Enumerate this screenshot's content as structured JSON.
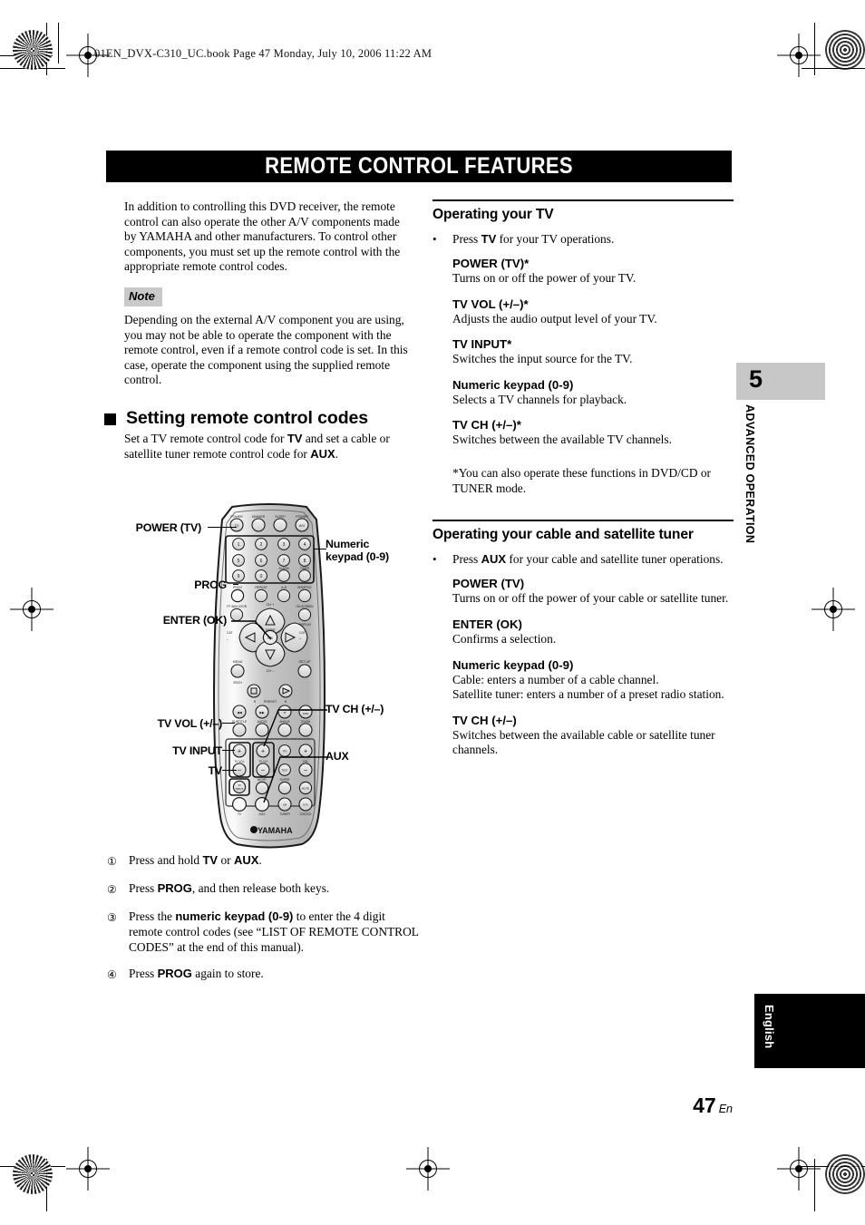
{
  "header": {
    "file_line": "01EN_DVX-C310_UC.book  Page 47  Monday, July 10, 2006  11:22 AM"
  },
  "title": "REMOTE CONTROL FEATURES",
  "left_column": {
    "intro": "In addition to controlling this DVD receiver, the remote control can also operate the other A/V components made by YAMAHA and other manufacturers. To control other components, you must set up the remote control with the appropriate remote control codes.",
    "note_label": "Note",
    "note_text": "Depending on the external A/V component you are using, you may not be able to operate the component with the remote control, even if a remote control code is set. In this case, operate the component using the supplied remote control.",
    "section_heading": "Setting remote control codes",
    "section_intro_1": "Set a TV remote control code for ",
    "section_intro_bold_1": "TV",
    "section_intro_2": " and set a cable or satellite tuner remote control code for ",
    "section_intro_bold_2": "AUX",
    "section_intro_3": "."
  },
  "figure": {
    "callouts_left": [
      {
        "label": "POWER (TV)"
      },
      {
        "label": "PROG"
      },
      {
        "label": "ENTER (OK)"
      },
      {
        "label": "TV VOL (+/–)"
      },
      {
        "label": "TV INPUT"
      },
      {
        "label": "TV"
      }
    ],
    "callouts_right": [
      {
        "label": "Numeric",
        "label2": "keypad (0-9)"
      },
      {
        "label": "TV CH (+/–)"
      },
      {
        "label": "AUX"
      }
    ],
    "remote_brand": "YAMAHA",
    "button_labels": {
      "top_row": [
        "POWER",
        "DIMMER",
        "SLEEP",
        "POWER"
      ],
      "top_row_inner": [
        "TV",
        "",
        "",
        "A/V"
      ],
      "keypad": [
        "1",
        "2",
        "3",
        "4",
        "5",
        "6",
        "7",
        "8",
        "9",
        "0"
      ],
      "row_prog": [
        "PROG",
        "REPEAT",
        "A-B",
        "SHUFFLE"
      ],
      "row_osd": [
        "TP INDICATOR",
        "ON SCREEN"
      ],
      "display": "DISPLAY",
      "nav_up": "CH +",
      "nav_down": "CH –",
      "nav_left": "CAT –",
      "nav_right": "CAT +",
      "enter": "ENTER",
      "enter_inner": "OK",
      "menu": "MENU",
      "setup": "SET UP",
      "srch": "SRCH",
      "preset": "PRESET",
      "row_media": [
        "SUBTITLE",
        "AUDIO",
        "ANGLE",
        "ZOOM"
      ],
      "tv_vol": "TV VOL",
      "tv_ch": "TV CH",
      "vol": "VOL",
      "tv_input": "TV INPUT",
      "test": "TEST",
      "mute": "MUTE",
      "night": "NIGHT",
      "super": "SUPER",
      "sources": [
        "TV",
        "AUX",
        "TUNER",
        "DVD/CD"
      ]
    }
  },
  "steps": [
    {
      "num": "①",
      "pre": "Press and hold ",
      "bold": "TV",
      "mid": " or ",
      "bold2": "AUX",
      "post": "."
    },
    {
      "num": "②",
      "pre": "Press ",
      "bold": "PROG",
      "mid": ", and then release both keys.",
      "bold2": "",
      "post": ""
    },
    {
      "num": "③",
      "pre": "Press the ",
      "bold": "numeric keypad (0-9)",
      "mid": " to enter the 4 digit remote control codes (see “LIST OF REMOTE CONTROL CODES” at the end of this manual).",
      "bold2": "",
      "post": ""
    },
    {
      "num": "④",
      "pre": "Press ",
      "bold": "PROG",
      "mid": " again to store.",
      "bold2": "",
      "post": ""
    }
  ],
  "right_column": {
    "section1": {
      "heading": "Operating your TV",
      "bullet_mark": "•",
      "bullet_pre": "Press ",
      "bullet_bold": "TV",
      "bullet_post": " for your TV operations.",
      "items": [
        {
          "term": "POWER (TV)*",
          "desc": "Turns on or off the power of your TV."
        },
        {
          "term": "TV VOL (+/–)*",
          "desc": "Adjusts the audio output level of your TV."
        },
        {
          "term": "TV INPUT*",
          "desc": "Switches the input source for the TV."
        },
        {
          "term": "Numeric keypad (0-9)",
          "desc": "Selects a TV channels for playback."
        },
        {
          "term": "TV CH (+/–)*",
          "desc": "Switches between the available TV channels."
        }
      ],
      "footnote": "*You can also operate these functions in DVD/CD or TUNER mode."
    },
    "section2": {
      "heading": "Operating your cable and satellite tuner",
      "bullet_mark": "•",
      "bullet_pre": "Press ",
      "bullet_bold": "AUX",
      "bullet_post": " for your cable and satellite tuner operations.",
      "items": [
        {
          "term": "POWER (TV)",
          "desc": "Turns on or off the power of your cable or satellite tuner."
        },
        {
          "term": "ENTER (OK)",
          "desc": "Confirms a selection."
        },
        {
          "term": "Numeric keypad (0-9)",
          "desc": "Cable: enters a number of a cable channel.\nSatellite tuner: enters a number of a preset radio station."
        },
        {
          "term": "TV CH (+/–)",
          "desc": "Switches between the available cable or satellite tuner channels."
        }
      ]
    }
  },
  "side_tabs": {
    "chapter_number": "5",
    "chapter_label": "ADVANCED OPERATION",
    "language_label": "English"
  },
  "page_number": {
    "number": "47",
    "suffix": "En"
  },
  "colors": {
    "black": "#000000",
    "note_gray": "#c9c9c9",
    "tab_gray": "#c7c7c7",
    "remote_body": "#bfbfbf"
  }
}
